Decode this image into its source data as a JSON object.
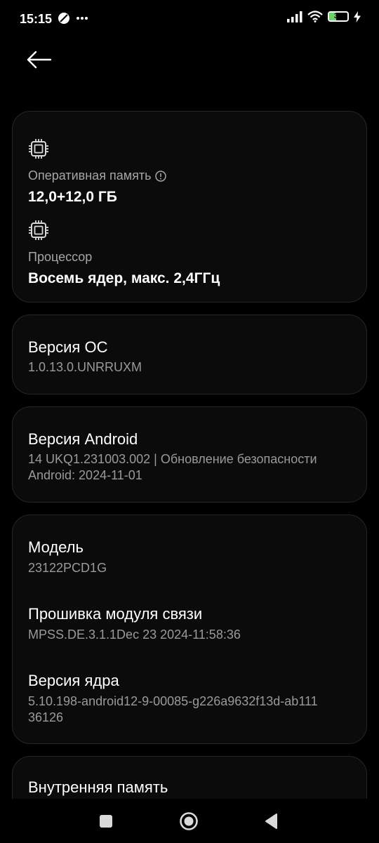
{
  "status_bar": {
    "time": "15:15",
    "battery": "39",
    "battery_level_percent": 39,
    "icons": [
      "do-not-disturb-icon",
      "more-notifications-icon",
      "signal-icon",
      "wifi-icon",
      "battery-icon",
      "charging-icon"
    ]
  },
  "hardware": {
    "ram_label": "Оперативная память",
    "ram_value": "12,0+12,0 ГБ",
    "cpu_label": "Процессор",
    "cpu_value": "Восемь ядер, макс. 2,4ГГц"
  },
  "os_version": {
    "title": "Версия ОС",
    "value": "1.0.13.0.UNRRUXM"
  },
  "android_version": {
    "title": "Версия Android",
    "value_line1": "14 UKQ1.231003.002 | Обновление безопасности",
    "value_line2": "Android: 2024-11-01"
  },
  "device_info": {
    "model_title": "Модель",
    "model_value": "23122PCD1G",
    "baseband_title": "Прошивка модуля связи",
    "baseband_value": "MPSS.DE.3.1.1Dec 23 2024-11:58:36",
    "kernel_title": "Версия ядра",
    "kernel_line1": "5.10.198-android12-9-00085-g226a9632f13d-ab111",
    "kernel_line2": "36126"
  },
  "storage": {
    "title": "Внутренняя память"
  },
  "colors": {
    "background": "#000000",
    "card": "#0b0b0b",
    "secondary_text": "#9a9a9a",
    "battery_fill": "#6ad06a"
  }
}
